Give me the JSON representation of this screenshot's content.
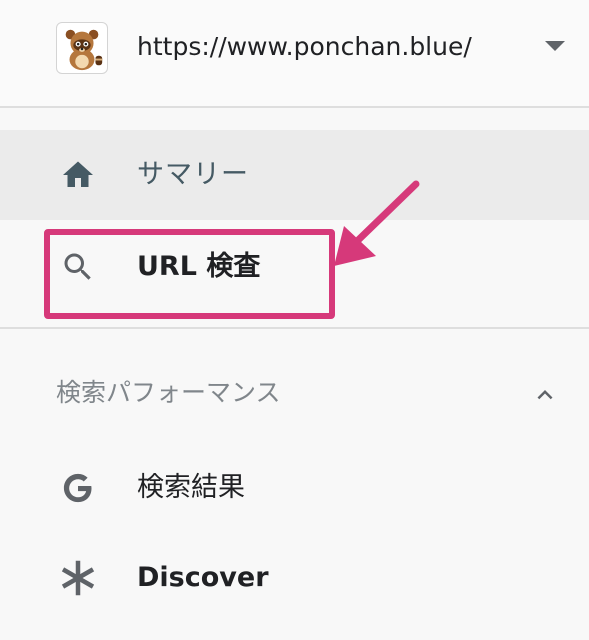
{
  "property": {
    "url": "https://www.ponchan.blue/",
    "favicon_icon": "tanuki-mascot-icon",
    "dropdown_icon": "dropdown-arrow-icon"
  },
  "nav": {
    "summary": {
      "label": "サマリー",
      "icon": "home-icon"
    },
    "url_inspection": {
      "label": "URL 検査",
      "icon": "search-icon"
    }
  },
  "performance_section": {
    "title": "検索パフォーマンス",
    "toggle_icon": "chevron-up-icon",
    "items": [
      {
        "label": "検索結果",
        "icon": "google-g-icon"
      },
      {
        "label": "Discover",
        "icon": "asterisk-icon"
      }
    ]
  },
  "annotation": {
    "highlight_color": "#d6397a"
  },
  "colors": {
    "active_background": "#ebebeb",
    "icon_gray": "#5f6368",
    "home_icon": "#455a64",
    "section_title": "#80868b"
  }
}
